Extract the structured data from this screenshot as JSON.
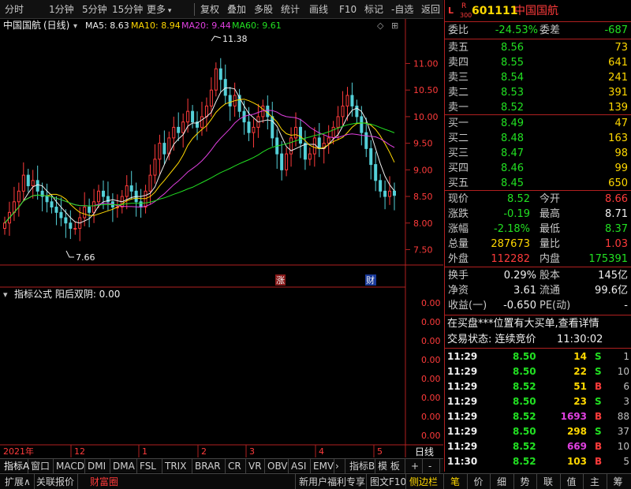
{
  "toolbar": {
    "left": [
      "分时",
      "1分钟",
      "5分钟",
      "15分钟",
      "更多"
    ],
    "right": [
      "复权",
      "叠加",
      "多股",
      "统计",
      "画线",
      "F10",
      "标记",
      "-自选",
      "返回"
    ]
  },
  "chart": {
    "name": "中国国航",
    "period": "(日线)",
    "ma": [
      {
        "label": "MA5: 8.63",
        "color": "#f0f0f0"
      },
      {
        "label": "MA10: 8.94",
        "color": "#ffd800"
      },
      {
        "label": "MA20: 9.44",
        "color": "#e040e0"
      },
      {
        "label": "MA60: 9.61",
        "color": "#22e022"
      }
    ],
    "price_axis": [
      "11.00",
      "10.50",
      "10.00",
      "9.50",
      "9.00",
      "8.50",
      "8.00",
      "7.50"
    ],
    "high_label": "11.38",
    "low_label": "7.66",
    "marks": {
      "rise": "涨",
      "fin": "财"
    },
    "indicator_title": "指标公式  阳后双阴: 0.00",
    "indicator_axis": [
      "0.00",
      "0.00",
      "0.00",
      "0.00",
      "0.00",
      "0.00",
      "0.00",
      "0.00"
    ],
    "time_labels": [
      "2021年",
      "12",
      "1",
      "2",
      "3",
      "4",
      "5"
    ],
    "axis_right_label": "日线"
  },
  "chart_data": {
    "type": "candlestick",
    "title": "中国国航 (日线)",
    "ylim": [
      7.3,
      11.6
    ],
    "yticks": [
      7.5,
      8.0,
      8.5,
      9.0,
      9.5,
      10.0,
      10.5,
      11.0
    ],
    "x_labels": [
      "2021年",
      "12",
      "1",
      "2",
      "3",
      "4",
      "5"
    ],
    "high": 11.38,
    "low": 7.66,
    "ma_latest": {
      "MA5": 8.63,
      "MA10": 8.94,
      "MA20": 9.44,
      "MA60": 9.61
    },
    "close_series": [
      8.0,
      8.2,
      8.4,
      8.6,
      8.9,
      8.7,
      8.8,
      8.6,
      8.5,
      8.4,
      8.3,
      8.2,
      8.1,
      8.0,
      7.9,
      7.9,
      8.1,
      8.3,
      8.2,
      8.4,
      8.6,
      8.5,
      8.4,
      8.3,
      8.3,
      8.5,
      8.7,
      8.6,
      8.4,
      8.3,
      8.6,
      8.9,
      9.2,
      9.5,
      9.3,
      9.6,
      9.8,
      9.7,
      9.9,
      10.1,
      9.9,
      9.8,
      10.0,
      10.2,
      10.5,
      10.9,
      10.7,
      10.4,
      10.2,
      10.4,
      10.1,
      9.9,
      9.7,
      9.8,
      10.0,
      10.2,
      10.0,
      9.6,
      9.3,
      9.0,
      9.3,
      9.6,
      9.8,
      9.5,
      9.2,
      9.3,
      9.6,
      9.4,
      9.5,
      9.6,
      9.8,
      10.0,
      10.2,
      10.4,
      10.2,
      10.0,
      9.7,
      9.4,
      9.1,
      8.8,
      8.6,
      8.5,
      8.6,
      8.52
    ],
    "indicator": {
      "name": "阳后双阴",
      "value": 0.0
    }
  },
  "quote": {
    "code": "601111",
    "name": "中国国航",
    "badge_l": "L",
    "badge_r": "R",
    "badge_300": "300",
    "weibi_label": "委比",
    "weibi": "-24.53%",
    "weicha_label": "委差",
    "weicha": "-687",
    "asks": [
      {
        "label": "卖五",
        "price": "8.56",
        "vol": "73"
      },
      {
        "label": "卖四",
        "price": "8.55",
        "vol": "641"
      },
      {
        "label": "卖三",
        "price": "8.54",
        "vol": "241"
      },
      {
        "label": "卖二",
        "price": "8.53",
        "vol": "391"
      },
      {
        "label": "卖一",
        "price": "8.52",
        "vol": "139"
      }
    ],
    "bids": [
      {
        "label": "买一",
        "price": "8.49",
        "vol": "47"
      },
      {
        "label": "买二",
        "price": "8.48",
        "vol": "163"
      },
      {
        "label": "买三",
        "price": "8.47",
        "vol": "98"
      },
      {
        "label": "买四",
        "price": "8.46",
        "vol": "99"
      },
      {
        "label": "买五",
        "price": "8.45",
        "vol": "650"
      }
    ],
    "stats": [
      {
        "l1": "现价",
        "v1": "8.52",
        "c1": "#22e022",
        "l2": "今开",
        "v2": "8.66",
        "c2": "#ff3b3b"
      },
      {
        "l1": "涨跌",
        "v1": "-0.19",
        "c1": "#22e022",
        "l2": "最高",
        "v2": "8.71",
        "c2": "#f0f0f0"
      },
      {
        "l1": "涨幅",
        "v1": "-2.18%",
        "c1": "#22e022",
        "l2": "最低",
        "v2": "8.37",
        "c2": "#22e022"
      },
      {
        "l1": "总量",
        "v1": "287673",
        "c1": "#ffd800",
        "l2": "量比",
        "v2": "1.03",
        "c2": "#ff3b3b"
      },
      {
        "l1": "外盘",
        "v1": "112282",
        "c1": "#ff3b3b",
        "l2": "内盘",
        "v2": "175391",
        "c2": "#22e022"
      }
    ],
    "fund": [
      {
        "l1": "换手",
        "v1": "0.29%",
        "l2": "股本",
        "v2": "145亿"
      },
      {
        "l1": "净资",
        "v1": "3.61",
        "l2": "流通",
        "v2": "99.6亿"
      },
      {
        "l1": "收益(一)",
        "v1": "-0.650",
        "l2": "PE(动)",
        "v2": "-"
      }
    ],
    "alert": "在买盘***位置有大买单,查看详情",
    "status_label": "交易状态: 连续竞价",
    "status_time": "11:30:02",
    "ticks": [
      {
        "t": "11:29",
        "p": "8.50",
        "v": "14",
        "vc": "#ffd800",
        "s": "S",
        "sc": "#22e022",
        "n": "1"
      },
      {
        "t": "11:29",
        "p": "8.50",
        "v": "22",
        "vc": "#ffd800",
        "s": "S",
        "sc": "#22e022",
        "n": "10"
      },
      {
        "t": "11:29",
        "p": "8.52",
        "v": "51",
        "vc": "#ffd800",
        "s": "B",
        "sc": "#ff3b3b",
        "n": "6"
      },
      {
        "t": "11:29",
        "p": "8.50",
        "v": "23",
        "vc": "#ffd800",
        "s": "S",
        "sc": "#22e022",
        "n": "3"
      },
      {
        "t": "11:29",
        "p": "8.52",
        "v": "1693",
        "vc": "#e040e0",
        "s": "B",
        "sc": "#ff3b3b",
        "n": "88"
      },
      {
        "t": "11:29",
        "p": "8.50",
        "v": "298",
        "vc": "#ffd800",
        "s": "S",
        "sc": "#22e022",
        "n": "37"
      },
      {
        "t": "11:29",
        "p": "8.52",
        "v": "669",
        "vc": "#e040e0",
        "s": "B",
        "sc": "#ff3b3b",
        "n": "10"
      },
      {
        "t": "11:30",
        "p": "8.52",
        "v": "103",
        "vc": "#ffd800",
        "s": "B",
        "sc": "#ff3b3b",
        "n": "5"
      }
    ]
  },
  "indicator_tabs": [
    "指标A",
    "窗口",
    "MACD",
    "DMI",
    "DMA",
    "FSL",
    "TRIX",
    "BRAR",
    "CR",
    "VR",
    "OBV",
    "ASI",
    "EMV",
    "指标B",
    "模 板",
    "+",
    "-"
  ],
  "bottom_tabs": {
    "left": [
      "扩展∧",
      "关联报价",
      "财富圈"
    ],
    "mid": [
      "新用户福利专享",
      "图文F10",
      "侧边栏"
    ],
    "right": [
      "笔",
      "价",
      "细",
      "势",
      "联",
      "值",
      "主",
      "筹"
    ]
  }
}
